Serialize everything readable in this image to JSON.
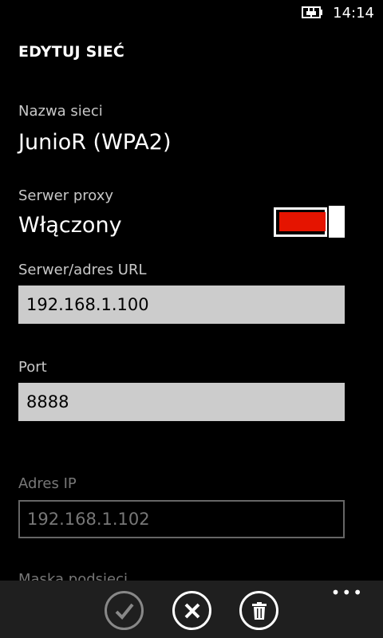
{
  "status_bar": {
    "time": "14:14",
    "battery_icon": "battery-charging-icon"
  },
  "page": {
    "title": "EDYTUJ SIEĆ"
  },
  "network": {
    "label": "Nazwa sieci",
    "value": "JunioR (WPA2)"
  },
  "proxy": {
    "label": "Serwer proxy",
    "value": "Włączony",
    "toggle_on": true,
    "accent": "#e51400"
  },
  "server": {
    "label": "Serwer/adres URL",
    "value": "192.168.1.100"
  },
  "port": {
    "label": "Port",
    "value": "8888"
  },
  "ip": {
    "label": "Adres IP",
    "value": "192.168.1.102"
  },
  "mask": {
    "label": "Maska podsieci"
  },
  "appbar": {
    "save_icon": "check-icon",
    "cancel_icon": "close-icon",
    "delete_icon": "trash-icon",
    "more": "•••"
  }
}
